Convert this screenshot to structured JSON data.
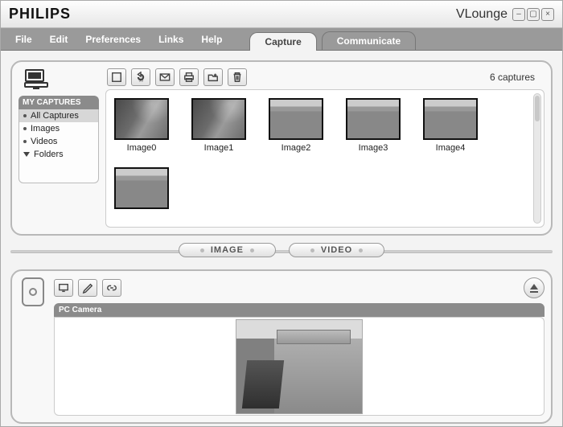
{
  "brand": "PHILIPS",
  "app_name": "VLounge",
  "menu": {
    "file": "File",
    "edit": "Edit",
    "preferences": "Preferences",
    "links": "Links",
    "help": "Help"
  },
  "tabs": {
    "capture": "Capture",
    "communicate": "Communicate",
    "active": "capture"
  },
  "sidebar": {
    "header": "MY CAPTURES",
    "items": [
      {
        "label": "All Captures",
        "marker": "bullet",
        "selected": true
      },
      {
        "label": "Images",
        "marker": "bullet",
        "selected": false
      },
      {
        "label": "Videos",
        "marker": "bullet",
        "selected": false
      },
      {
        "label": "Folders",
        "marker": "caret",
        "selected": false
      }
    ]
  },
  "toolbar_icons": {
    "fullscreen": "fullscreen-icon",
    "rotate": "rotate-icon",
    "email": "email-icon",
    "print": "print-icon",
    "new_folder": "new-folder-icon",
    "delete": "delete-icon"
  },
  "captures_count_label": "6 captures",
  "thumbs": [
    {
      "label": "Image0",
      "style": "lens"
    },
    {
      "label": "Image1",
      "style": "lens"
    },
    {
      "label": "Image2",
      "style": "room"
    },
    {
      "label": "Image3",
      "style": "room"
    },
    {
      "label": "Image4",
      "style": "room"
    },
    {
      "label": "",
      "style": "room"
    }
  ],
  "mid_buttons": {
    "image": "IMAGE",
    "video": "VIDEO"
  },
  "lower": {
    "header": "PC Camera",
    "toolbar": {
      "display": "display-icon",
      "settings": "settings-icon",
      "link": "link-icon"
    },
    "eject": "eject-button"
  }
}
